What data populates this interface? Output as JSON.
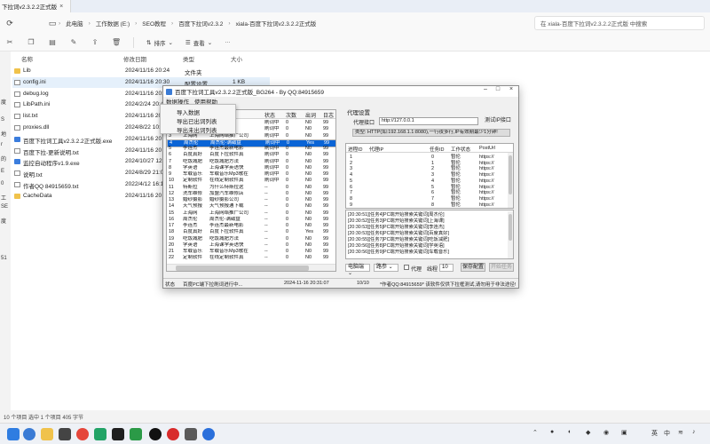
{
  "explorer": {
    "tab_title": "下拉词v2.3.2.2正式版",
    "breadcrumbs": [
      "此电脑",
      "工作数据 (E:)",
      "SEO教程",
      "百度下拉词v2.3.2",
      "xiala-百度下拉词v2.3.2.2正式版"
    ],
    "search_placeholder": "在 xiala-百度下拉词v2.3.2.2正式版 中搜索",
    "toolbar": {
      "sort_label": "排序",
      "view_label": "查看"
    },
    "columns": {
      "name": "名称",
      "date": "修改日期",
      "type": "类型",
      "size": "大小"
    },
    "files": [
      {
        "name": "Lib",
        "date": "2024/11/16 20:24",
        "type": "文件夹",
        "size": "",
        "kind": "folder"
      },
      {
        "name": "config.ini",
        "date": "2024/11/16 20:30",
        "type": "配置设置",
        "size": "1 KB",
        "kind": "file"
      },
      {
        "name": "debug.log",
        "date": "2024/11/16 20:30",
        "type": "",
        "size": "",
        "kind": "file"
      },
      {
        "name": "LibPath.ini",
        "date": "2024/2/24 20:47",
        "type": "",
        "size": "",
        "kind": "file"
      },
      {
        "name": "list.txt",
        "date": "2024/11/16 20:31",
        "type": "",
        "size": "",
        "kind": "file"
      },
      {
        "name": "proxies.dll",
        "date": "2024/8/22 10:20",
        "type": "",
        "size": "",
        "kind": "file"
      },
      {
        "name": "百度下拉词工具v2.3.2.2正式版.exe",
        "date": "2024/11/16 20",
        "type": "",
        "size": "",
        "kind": "exe"
      },
      {
        "name": "百度下拉-更新说明.txt",
        "date": "2024/11/16 20",
        "type": "",
        "size": "",
        "kind": "file"
      },
      {
        "name": "监控自动程序v1.9.exe",
        "date": "2024/10/27 12",
        "type": "",
        "size": "",
        "kind": "exe"
      },
      {
        "name": "说明.txt",
        "date": "2024/8/29 21:0",
        "type": "",
        "size": "",
        "kind": "file"
      },
      {
        "name": "作者QQ 84915659.txt",
        "date": "2022/4/12 16:10",
        "type": "",
        "size": "",
        "kind": "file"
      },
      {
        "name": "CacheData",
        "date": "2024/11/16 20",
        "type": "",
        "size": "",
        "kind": "folder"
      }
    ],
    "left_labels": [
      "度",
      "S",
      "地",
      "r",
      "的",
      "E",
      "0",
      "工",
      "SE",
      "度",
      "51"
    ],
    "status": "10 个项目  选中 1 个项目  405 字节"
  },
  "app": {
    "title": "百度下拉词工具v2.3.2.2正式版_BG264 - By QQ:84915659",
    "menu": [
      "数据操作",
      "使用帮助"
    ],
    "dropdown": [
      "导入数据",
      "导出已出词列表",
      "导出未出词列表"
    ],
    "grid": {
      "headers": [
        "",
        "状态",
        "次数",
        "出词",
        "日志"
      ],
      "rows": [
        [
          "1",
          "",
          "",
          "刷词中",
          "0",
          "N0",
          "99"
        ],
        [
          "2",
          "",
          "",
          "刷词中",
          "0",
          "N0",
          "99"
        ],
        [
          "3",
          "上海网",
          "上海网络推广公司",
          "刷词中",
          "0",
          "N0",
          "99"
        ],
        [
          "4",
          "周杰伦",
          "周杰伦-满磁盘",
          "刷词中",
          "0",
          "Yes",
          "99"
        ],
        [
          "5",
          "李连杰",
          "李连杰最新电影",
          "刷词中",
          "0",
          "N0",
          "99"
        ],
        [
          "6",
          "百度真好",
          "百度下拉软件真",
          "刷词中",
          "0",
          "N0",
          "99"
        ],
        [
          "7",
          "吃饭减肥",
          "吃饭减肥方法",
          "刷词中",
          "0",
          "N0",
          "99"
        ],
        [
          "8",
          "学英语",
          "上海课学英语快",
          "刷词中",
          "0",
          "N0",
          "99"
        ],
        [
          "9",
          "车载音乐",
          "车载音乐Mp3歌在",
          "刷词中",
          "0",
          "N0",
          "99"
        ],
        [
          "10",
          "定制软件",
          "在线定制软件真",
          "刷词中",
          "0",
          "N0",
          "99"
        ],
        [
          "11",
          "特斯拉",
          "为什么特斯拉这",
          "--",
          "0",
          "N0",
          "99"
        ],
        [
          "12",
          "洗车维修",
          "加盟汽车维修店",
          "--",
          "0",
          "N0",
          "99"
        ],
        [
          "13",
          "婚纱摄影",
          "婚纱摄影公司",
          "--",
          "0",
          "N0",
          "99"
        ],
        [
          "14",
          "天气预报",
          "天气预报通下载",
          "--",
          "0",
          "N0",
          "99"
        ],
        [
          "15",
          "上海网",
          "上海网络推广公司",
          "--",
          "0",
          "N0",
          "99"
        ],
        [
          "16",
          "周杰伦",
          "周杰伦-满磁盘",
          "--",
          "0",
          "N0",
          "99"
        ],
        [
          "17",
          "李连杰",
          "李连杰最新电影",
          "--",
          "0",
          "N0",
          "99"
        ],
        [
          "18",
          "百度真好",
          "百度下拉软件真",
          "--",
          "0",
          "Yes",
          "99"
        ],
        [
          "19",
          "吃饭减肥",
          "吃饭减肥方法",
          "--",
          "0",
          "N0",
          "99"
        ],
        [
          "20",
          "学英语",
          "上海课学英语快",
          "--",
          "0",
          "N0",
          "99"
        ],
        [
          "21",
          "车载音乐",
          "车载音乐Mp3歌在",
          "--",
          "0",
          "N0",
          "99"
        ],
        [
          "22",
          "定制软件",
          "在线定制软件真",
          "--",
          "0",
          "N0",
          "99"
        ]
      ]
    },
    "proxy": {
      "section_title": "代理设置",
      "api_label": "代理接口",
      "api_value": "http://127.0.0.1",
      "test_button": "测试IP接口",
      "type_text": "类型: HTTP(如:192.168.1.1:8080),一行夜多行,IP有效期最少1分钟!"
    },
    "proxy_table": {
      "headers": [
        "进程ID",
        "代理IP",
        "任务ID",
        "工作状态",
        "PostUrl"
      ],
      "rows": [
        [
          "1",
          "",
          "0",
          "暂伦",
          "https://"
        ],
        [
          "2",
          "",
          "1",
          "暂伦",
          "https://"
        ],
        [
          "3",
          "",
          "2",
          "暂伦",
          "https://"
        ],
        [
          "4",
          "",
          "3",
          "暂伦",
          "https://"
        ],
        [
          "5",
          "",
          "4",
          "暂伦",
          "https://"
        ],
        [
          "6",
          "",
          "5",
          "暂伦",
          "https://"
        ],
        [
          "7",
          "",
          "6",
          "暂伦",
          "https://"
        ],
        [
          "8",
          "",
          "7",
          "暂伦",
          "https://"
        ],
        [
          "9",
          "",
          "8",
          "暂伦",
          "https://"
        ]
      ]
    },
    "log": [
      "[20:30:51][任务4]PC端开始搜索关键词[周杰伦]",
      "[20:30:52][任务3]PC端开始搜索关键词[上海课]",
      "[20:30:53][任务5]PC端开始搜索关键词[李连杰]",
      "[20:30:53][任务6]PC端开始搜索关键词[百度真好]",
      "[20:30:55][任务7]PC端开始搜索关键词[吃饭减肥]",
      "[20:30:56][任务8]PC端开始搜索关键词[学英语]",
      "[20:30:56][任务9]PC端开始搜索关键词[车载音乐]"
    ],
    "controls": {
      "platform": "电脑端",
      "param": "路参",
      "proxy_checkbox": "代理",
      "threads_label": "线程",
      "threads_value": "10",
      "save_button": "保存配置",
      "start_button": "开始任务"
    },
    "status": {
      "label": "状态",
      "running": "百度PC端下拉刷词进行中...",
      "time": "2024-11-16 20:31:07",
      "count": "10/10",
      "notice": "*作者QQ:84915659* 该软件仅供下拉框测试,请勿用于非法途径!"
    }
  },
  "taskbar": {
    "lang": "英",
    "ime": "中"
  }
}
